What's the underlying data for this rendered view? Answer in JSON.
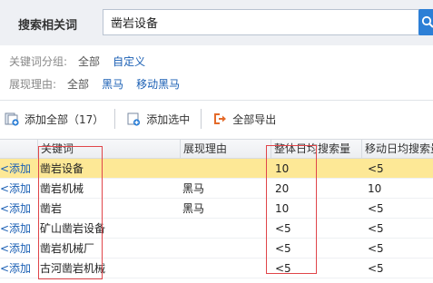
{
  "search": {
    "label": "搜索相关词",
    "value": "凿岩设备"
  },
  "filters": {
    "group": {
      "label": "关键词分组:",
      "options": [
        "全部",
        "自定义"
      ]
    },
    "reason": {
      "label": "展现理由:",
      "options": [
        "全部",
        "黑马",
        "移动黑马"
      ]
    }
  },
  "toolbar": {
    "add_all": "添加全部（17）",
    "add_selected": "添加选中",
    "export_all": "全部导出"
  },
  "table": {
    "columns": [
      "",
      "关键词",
      "展现理由",
      "整体日均搜索量",
      "移动日均搜索量"
    ],
    "add_label": "<添加",
    "rows": [
      {
        "keyword": "凿岩设备",
        "reason": "",
        "total": "10",
        "mobile": "<5"
      },
      {
        "keyword": "凿岩机械",
        "reason": "黑马",
        "total": "20",
        "mobile": "10"
      },
      {
        "keyword": "凿岩",
        "reason": "黑马",
        "total": "10",
        "mobile": "<5"
      },
      {
        "keyword": "矿山凿岩设备",
        "reason": "",
        "total": "<5",
        "mobile": "<5"
      },
      {
        "keyword": "凿岩机械厂",
        "reason": "",
        "total": "<5",
        "mobile": "<5"
      },
      {
        "keyword": "古河凿岩机械",
        "reason": "",
        "total": "<5",
        "mobile": "<5"
      }
    ]
  },
  "colors": {
    "highlight_row": "#fde896",
    "link": "#1a5fb4",
    "annotation": "#e0454a",
    "search_button": "#2c7fd6"
  }
}
